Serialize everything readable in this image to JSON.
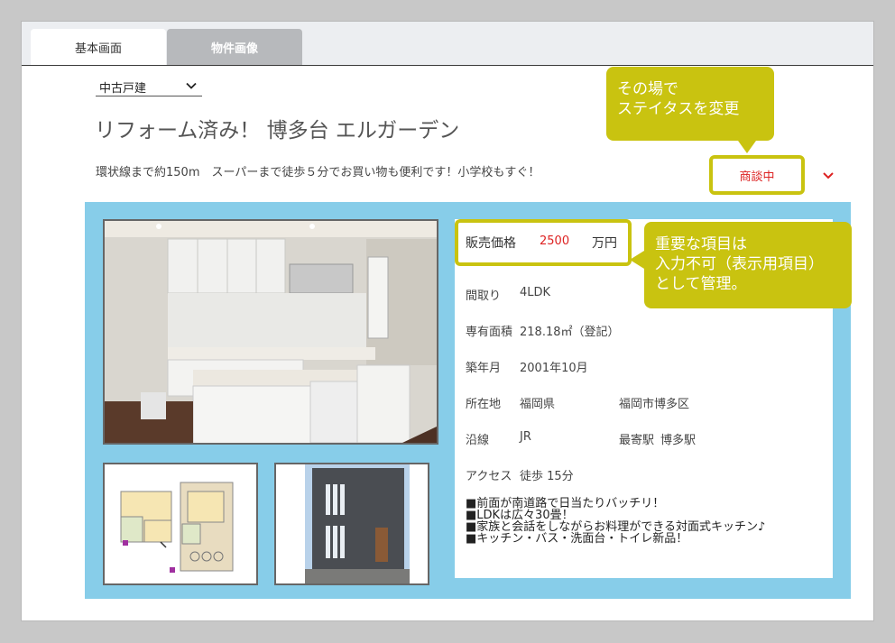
{
  "tabs": [
    {
      "label": "基本画面",
      "active": true
    },
    {
      "label": "物件画像",
      "active": false
    }
  ],
  "property_type": {
    "selected": "中古戸建"
  },
  "title": "リフォーム済み！ 博多台 エルガーデン",
  "subtitle": "環状線まで約150m　スーパーまで徒歩５分でお買い物も便利です！小学校もすぐ！",
  "status": {
    "selected": "商談中"
  },
  "callouts": {
    "status_line1": "その場で",
    "status_line2": "ステイタスを変更",
    "important_line1": "重要な項目は",
    "important_line2": "入力不可（表示用項目）",
    "important_line3": "として管理。"
  },
  "details": {
    "price_label": "販売価格",
    "price_value": "2500",
    "price_unit": "万円",
    "layout_label": "間取り",
    "layout_value": "4LDK",
    "area_label": "専有面積",
    "area_value": "218.18㎡（登記）",
    "built_label": "築年月",
    "built_value": "2001年10月",
    "address_label": "所在地",
    "prefecture": "福岡県",
    "city": "福岡市博多区",
    "line_label": "沿線",
    "line_value": "JR",
    "station_label": "最寄駅",
    "station_value": "博多駅",
    "access_label": "アクセス",
    "access_value": "徒歩 15分"
  },
  "notes": [
    "■前面が南道路で日当たりバッチリ！",
    "■LDKは広々30畳！",
    "■家族と会話をしながらお料理ができる対面式キッチン♪",
    "■キッチン・バス・洗面台・トイレ新品！"
  ],
  "colors": {
    "accent": "#c9c310",
    "panel": "#87cde9",
    "status_text": "#dd2222"
  }
}
